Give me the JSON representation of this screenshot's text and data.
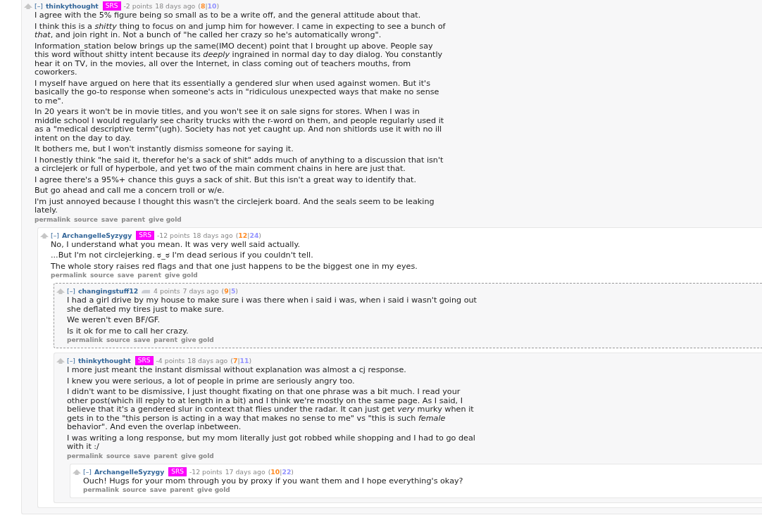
{
  "comments": [
    {
      "toggle": "[–]",
      "author": "thinkythought",
      "flair": "SRS",
      "score": "-2 points",
      "time": "18 days ago",
      "votes": {
        "open": "(",
        "ups": "8",
        "sep": "|",
        "downs": "10",
        "close": ")"
      },
      "highlighted": false,
      "paragraphs": [
        "I agree with the 5% figure being so small as to be a write off, and the general attitude about that.",
        "I think this is a *shitty* thing to focus on and jump him for however. I came in expecting to see a bunch of *that*, and join right in. Not a bunch of \"he called her crazy so he's automatically wrong\".",
        "Information_station below brings up the same(IMO decent) point that I brought up above. People say this word without shitty intent because its *deeply* ingrained in normal day to day dialog. You constantly hear it on TV, in the movies, all over the Internet, in class coming out of teachers mouths, from coworkers.",
        "I myself have argued on here that its essentially a gendered slur when used against women. But it's basically the go-to response when someone's acts in \"ridiculous unexpected ways that make no sense to me\".",
        "In 20 years it won't be in movie titles, and you won't see it on sale signs for stores. When I was in middle school I would regularly see charity trucks with the r-word on them, and people regularly used it as a \"medical descriptive term\"(ugh). Society has not yet caught up. And non shitlords use it with no ill intent on the day to day.",
        "It bothers me, but I won't instantly dismiss someone for saying it.",
        "I honestly think \"he said it, therefor he's a sack of shit\" adds much of anything to a discussion that isn't a circlejerk or full of hyperbole, and yet two of the main comment chains in here are just that.",
        "I agree there's a 95%+ chance this guys a sack of shit. But this isn't a great way to identify that.",
        "But go ahead and call me a concern troll or w/e.",
        "I'm just annoyed because I thought this wasn't the circlejerk board. And the seals seem to be leaking lately."
      ],
      "buttons": [
        "permalink",
        "source",
        "save",
        "parent",
        "give gold"
      ],
      "children": [
        {
          "toggle": "[–]",
          "author": "ArchangelleSyzygy",
          "flair": "SRS",
          "score": "-12 points",
          "time": "18 days ago",
          "votes": {
            "open": "(",
            "ups": "12",
            "sep": "|",
            "downs": "24",
            "close": ")"
          },
          "highlighted": false,
          "paragraphs": [
            "No, I understand what you mean. It was very well said actually.",
            "...But I'm not circlejerking. ಠ_ಠ I'm dead serious if you couldn't tell.",
            "The whole story raises red flags and that one just happens to be the biggest one in my eyes."
          ],
          "buttons": [
            "permalink",
            "source",
            "save",
            "parent",
            "give gold"
          ],
          "children": [
            {
              "toggle": "[–]",
              "author": "changingstuff12",
              "flair_icon": true,
              "score": "4 points",
              "time": "7 days ago",
              "votes": {
                "open": "(",
                "ups": "9",
                "sep": "|",
                "downs": "5",
                "close": ")"
              },
              "highlighted": true,
              "paragraphs": [
                "I had a girl drive by my house to make sure i was there when i said i was, when i said i wasn't going out she deflated my tires just to make sure.",
                "We weren't even BF/GF.",
                "Is it ok for me to call her crazy."
              ],
              "buttons": [
                "permalink",
                "source",
                "save",
                "parent",
                "give gold"
              ]
            },
            {
              "toggle": "[–]",
              "author": "thinkythought",
              "flair": "SRS",
              "score": "-4 points",
              "time": "18 days ago",
              "votes": {
                "open": "(",
                "ups": "7",
                "sep": "|",
                "downs": "11",
                "close": ")"
              },
              "highlighted": false,
              "paragraphs": [
                "I more just meant the instant dismissal without explanation was almost a cj response.",
                "I knew you were serious, a lot of people in prime are seriously angry too.",
                "I didn't want to be dismissive, I just thought fixating on that one phrase was a bit much. I read your other post(which ill reply to at length in a bit) and I think we're mostly on the same page. As I said, I believe that it's a gendered slur in context that flies under the radar. It can just get *very* murky when it gets in to the \"this person is acting in a way that makes no sense to me\" vs \"this is such *female* behavior\". And even the overlap inbetween.",
                "I was writing a long response, but my mom literally just got robbed while shopping and I had to go deal with it :/"
              ],
              "buttons": [
                "permalink",
                "source",
                "save",
                "parent",
                "give gold"
              ],
              "children": [
                {
                  "toggle": "[–]",
                  "author": "ArchangelleSyzygy",
                  "flair": "SRS",
                  "score": "-12 points",
                  "time": "17 days ago",
                  "votes": {
                    "open": "(",
                    "ups": "10",
                    "sep": "|",
                    "downs": "22",
                    "close": ")"
                  },
                  "highlighted": false,
                  "paragraphs": [
                    "Ouch! Hugs for your mom through you by proxy if you want them and I hope everything's okay?"
                  ],
                  "buttons": [
                    "permalink",
                    "source",
                    "save",
                    "parent",
                    "give gold"
                  ]
                }
              ]
            }
          ]
        }
      ]
    }
  ]
}
